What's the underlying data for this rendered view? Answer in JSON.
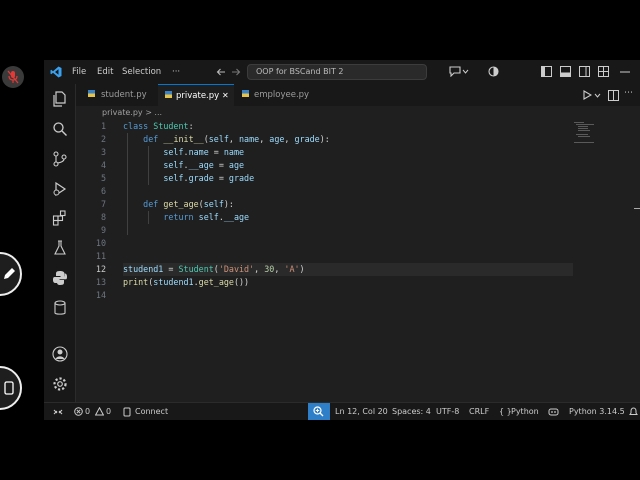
{
  "titlebar": {
    "menu": [
      "File",
      "Edit",
      "Selection"
    ],
    "more": "···",
    "search": "OOP for BSCand BIT 2"
  },
  "tabs": [
    {
      "label": "student.py",
      "active": false
    },
    {
      "label": "private.py",
      "active": true,
      "close": "✕"
    },
    {
      "label": "employee.py",
      "active": false
    }
  ],
  "breadcrumb": {
    "file": "private.py",
    "sep": "> ..."
  },
  "editor": {
    "current_line": 12,
    "line_numbers": [
      "1",
      "2",
      "3",
      "4",
      "5",
      "6",
      "7",
      "8",
      "9",
      "10",
      "11",
      "12",
      "13",
      "14"
    ]
  },
  "statusbar": {
    "errors": "0",
    "warnings": "0",
    "connect": "Connect",
    "position": "Ln 12, Col 20",
    "spaces": "Spaces: 4",
    "encoding": "UTF-8",
    "eol": "CRLF",
    "language": "Python",
    "interpreter": "Python 3.14.5"
  },
  "colors": {
    "accent": "#0078d4",
    "keyword": "#569cd6",
    "function": "#dcdcaa",
    "class": "#4ec9b0",
    "string": "#ce9178",
    "number": "#b5cea8"
  }
}
